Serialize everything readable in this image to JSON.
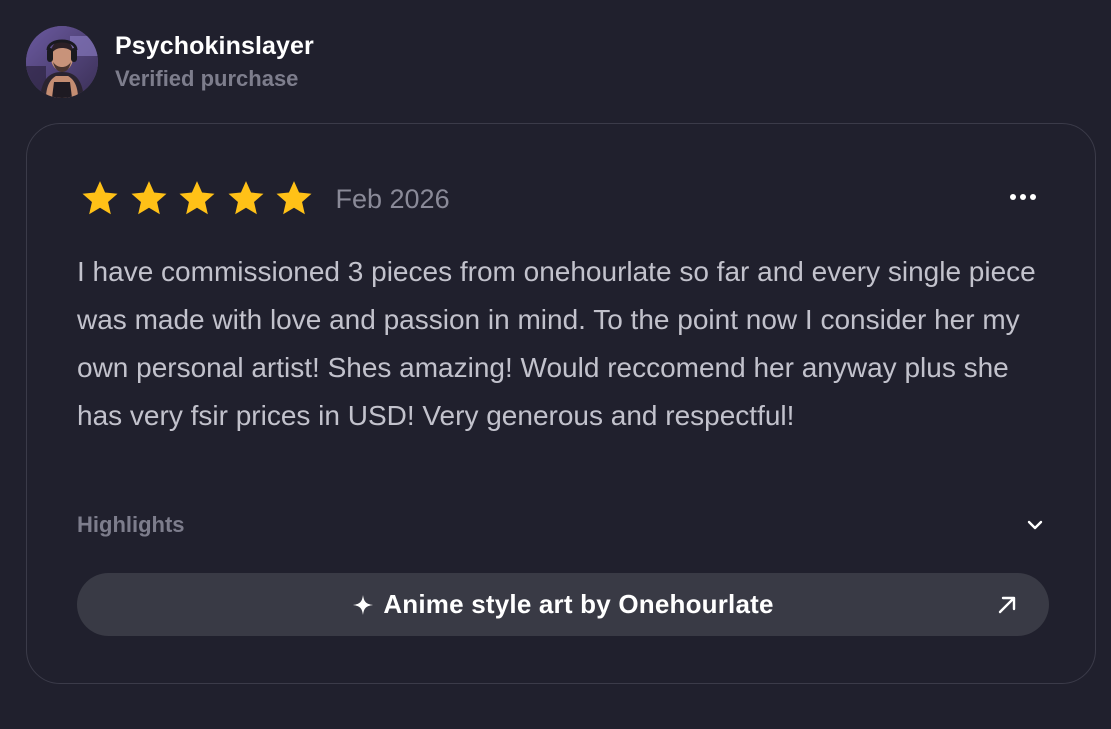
{
  "reviewer": {
    "name": "Psychokinslayer",
    "badge": "Verified purchase",
    "avatar_icon": "user-avatar"
  },
  "review": {
    "rating": 5,
    "max_rating": 5,
    "star_color": "#ffc117",
    "date": "Feb 2026",
    "text": "I have commissioned 3 pieces from onehourlate so far and every single piece was made with love and passion in mind. To the point now I consider her my own personal artist! Shes amazing! Would reccomend her anyway plus she has very fsir prices in USD! Very generous and respectful!",
    "more_icon": "more-horizontal-icon"
  },
  "highlights": {
    "label": "Highlights",
    "icon": "chevron-down-icon"
  },
  "product_link": {
    "prefix_icon": "sparkle-icon",
    "label": "Anime style art by Onehourlate",
    "suffix_icon": "external-link-arrow-icon"
  },
  "colors": {
    "background": "#20202d",
    "card_border": "#3b3b49",
    "button_bg": "#393a45",
    "muted_text": "#7d7d8c",
    "body_text": "#c2c2cc"
  }
}
